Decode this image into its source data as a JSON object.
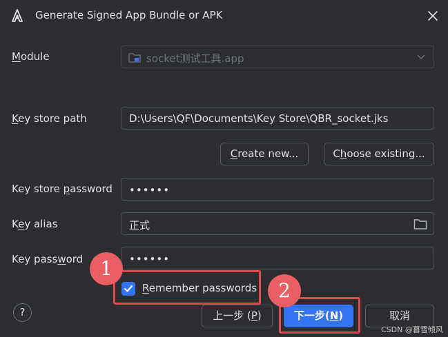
{
  "window": {
    "title": "Generate Signed App Bundle or APK"
  },
  "form": {
    "module": {
      "label_mn": "M",
      "label_rest": "odule",
      "value": "socket测试工具.app"
    },
    "keystore_path": {
      "label_mn": "K",
      "label_rest": "ey store path",
      "value": "D:\\Users\\QF\\Documents\\Key Store\\QBR_socket.jks"
    },
    "create_new": {
      "mn": "C",
      "rest": "reate new..."
    },
    "choose_existing": {
      "pre": "C",
      "mn": "h",
      "rest": "oose existing..."
    },
    "keystore_password": {
      "label_pre": "Key store ",
      "label_mn": "p",
      "label_rest": "assword",
      "value": "••••••"
    },
    "key_alias": {
      "label_pre": "K",
      "label_mn": "e",
      "label_rest": "y alias",
      "value": "正式"
    },
    "key_password": {
      "label_pre": "Key pass",
      "label_mn": "w",
      "label_rest": "ord",
      "value": "••••••"
    },
    "remember": {
      "mn": "R",
      "rest": "emember passwords",
      "checked": true
    }
  },
  "footer": {
    "help": "?",
    "prev": {
      "pre": "上一步 (",
      "mn": "P",
      "post": ")"
    },
    "next": {
      "pre": "下一步(",
      "mn": "N",
      "post": ")"
    },
    "cancel": "取消"
  },
  "annotations": {
    "marker1": "1",
    "marker2": "2"
  },
  "watermark": "CSDN @暮雪倾风",
  "colors": {
    "background": "#2b2d30",
    "accent": "#3574f0",
    "highlight": "#e04a4f",
    "marker": "#e85e62"
  }
}
